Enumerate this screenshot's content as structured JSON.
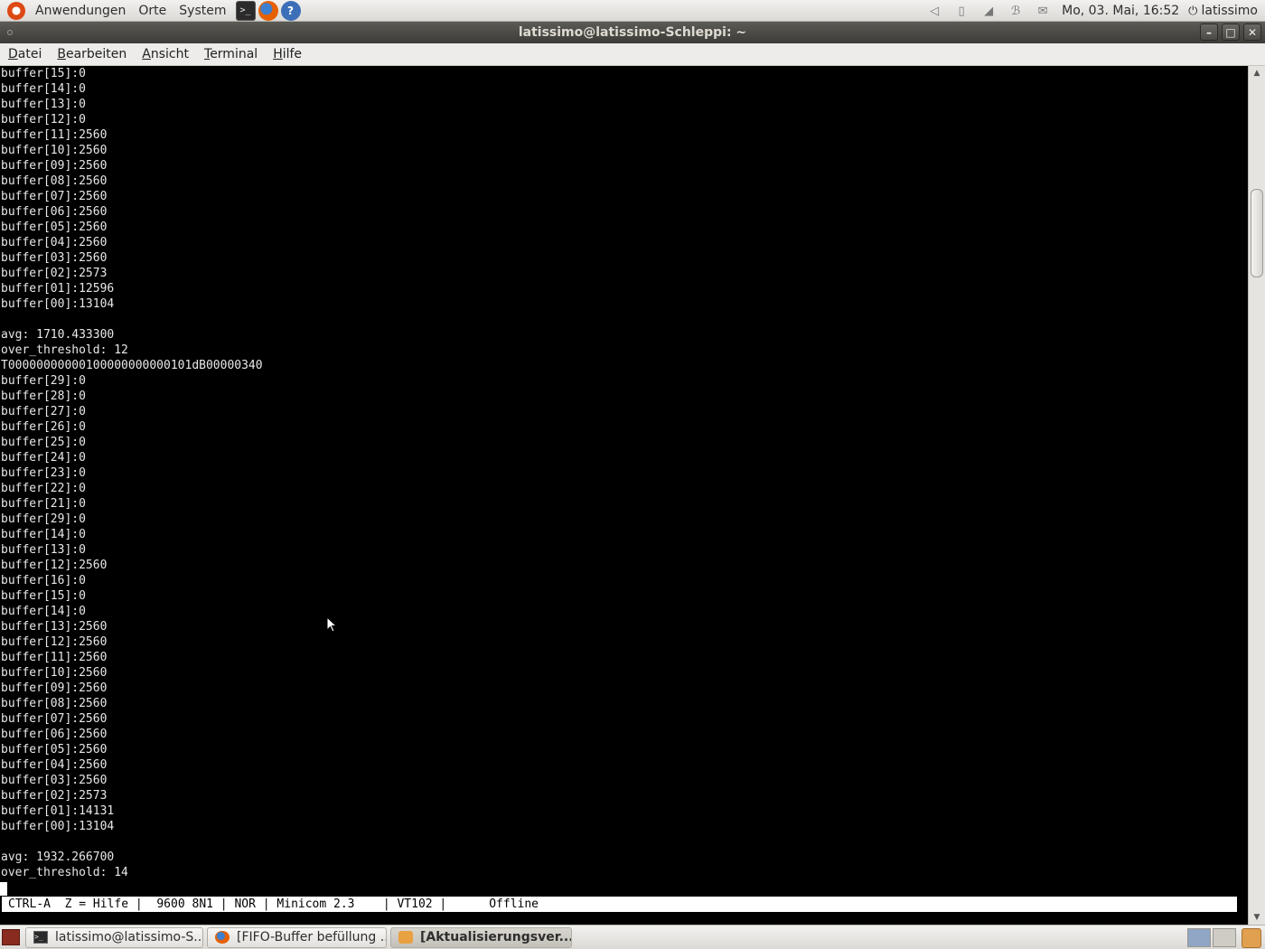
{
  "top_panel": {
    "menus": [
      "Anwendungen",
      "Orte",
      "System"
    ],
    "launchers": [
      "terminal-icon",
      "firefox-icon",
      "help-icon"
    ],
    "clock": "Mo, 03. Mai, 16:52",
    "user": "latissimo"
  },
  "window": {
    "title": "latissimo@latissimo-Schleppi: ~"
  },
  "menubar": {
    "items": [
      {
        "first": "D",
        "rest": "atei"
      },
      {
        "first": "B",
        "rest": "earbeiten"
      },
      {
        "first": "A",
        "rest": "nsicht"
      },
      {
        "first": "T",
        "rest": "erminal"
      },
      {
        "first": "H",
        "rest": "ilfe"
      }
    ]
  },
  "terminal": {
    "lines": [
      "buffer[15]:0",
      "buffer[14]:0",
      "buffer[13]:0",
      "buffer[12]:0",
      "buffer[11]:2560",
      "buffer[10]:2560",
      "buffer[09]:2560",
      "buffer[08]:2560",
      "buffer[07]:2560",
      "buffer[06]:2560",
      "buffer[05]:2560",
      "buffer[04]:2560",
      "buffer[03]:2560",
      "buffer[02]:2573",
      "buffer[01]:12596",
      "buffer[00]:13104",
      "",
      "avg: 1710.433300",
      "over_threshold: 12",
      "T00000000000100000000000101dB00000340",
      "buffer[29]:0",
      "buffer[28]:0",
      "buffer[27]:0",
      "buffer[26]:0",
      "buffer[25]:0",
      "buffer[24]:0",
      "buffer[23]:0",
      "buffer[22]:0",
      "buffer[21]:0",
      "buffer[29]:0",
      "buffer[14]:0",
      "buffer[13]:0",
      "buffer[12]:2560",
      "buffer[16]:0",
      "buffer[15]:0",
      "buffer[14]:0",
      "buffer[13]:2560",
      "buffer[12]:2560",
      "buffer[11]:2560",
      "buffer[10]:2560",
      "buffer[09]:2560",
      "buffer[08]:2560",
      "buffer[07]:2560",
      "buffer[06]:2560",
      "buffer[05]:2560",
      "buffer[04]:2560",
      "buffer[03]:2560",
      "buffer[02]:2573",
      "buffer[01]:14131",
      "buffer[00]:13104",
      "",
      "avg: 1932.266700",
      "over_threshold: 14"
    ],
    "status_line": "CTRL-A  Z = Hilfe |  9600 8N1 | NOR | Minicom 2.3    | VT102 |      Offline"
  },
  "taskbar": {
    "tasks": [
      {
        "label": "latissimo@latissimo-S...",
        "icon": "terminal-icon",
        "active": false
      },
      {
        "label": "[FIFO-Buffer befüllung ...",
        "icon": "firefox-icon",
        "active": false
      },
      {
        "label": "[Aktualisierungsver...",
        "icon": "update-manager-icon",
        "active": true
      }
    ]
  }
}
